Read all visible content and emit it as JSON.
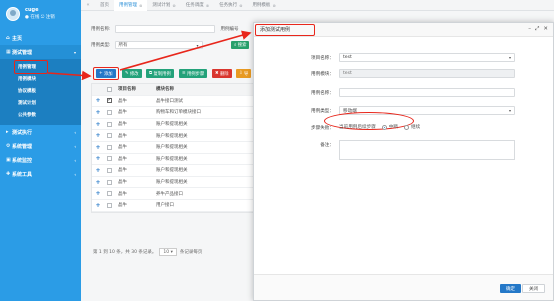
{
  "sidebar": {
    "user_name": "cuge",
    "user_status": "● 在线  ⎋ 注销",
    "items": [
      {
        "label": "主页",
        "icon": "home-icon"
      },
      {
        "label": "测试管理",
        "icon": "grid-icon"
      },
      {
        "label": "测试执行",
        "icon": "play-icon"
      },
      {
        "label": "系统管理",
        "icon": "gear-icon"
      },
      {
        "label": "系统监控",
        "icon": "monitor-icon"
      },
      {
        "label": "系统工具",
        "icon": "tools-icon"
      }
    ],
    "sub_items": [
      "用例管理",
      "用例模块",
      "协议模板",
      "测试计划",
      "公共参数"
    ]
  },
  "tabs": [
    "首页",
    "用例管理",
    "测试计划",
    "任务调度",
    "任务执行",
    "用例模板"
  ],
  "search": {
    "case_name_label": "用例名称:",
    "case_no_label": "用例编号",
    "case_type_label": "用例类型:",
    "case_type_value": "所有",
    "search_label": "搜索"
  },
  "toolbar": {
    "add_label": "添加",
    "edit_label": "修改",
    "copy_label": "复制用例",
    "export_label": "用例步骤",
    "delete_label": "删除",
    "more_label": "导"
  },
  "table": {
    "headers": [
      "项目名称",
      "模块名称"
    ],
    "rows": [
      {
        "project": "晶牛",
        "module": "晶牛接口测试",
        "checked": true
      },
      {
        "project": "晶牛",
        "module": "购物车和订单模块接口",
        "checked": false
      },
      {
        "project": "晶牛",
        "module": "账户和提现相关",
        "checked": false
      },
      {
        "project": "晶牛",
        "module": "账户和提现相关",
        "checked": false
      },
      {
        "project": "晶牛",
        "module": "账户和提现相关",
        "checked": false
      },
      {
        "project": "晶牛",
        "module": "账户和提现相关",
        "checked": false
      },
      {
        "project": "晶牛",
        "module": "账户和提现相关",
        "checked": false
      },
      {
        "project": "晶牛",
        "module": "账户和提现相关",
        "checked": false
      },
      {
        "project": "晶牛",
        "module": "养牛产品接口",
        "checked": false
      },
      {
        "project": "晶牛",
        "module": "用户接口",
        "checked": false
      }
    ]
  },
  "pager": {
    "summary": "第 1 到 10 条，共 30 条记录。",
    "per_page": "10",
    "suffix": "条记录每页"
  },
  "dialog": {
    "title": "添加测试用例",
    "project_label": "项目名称：",
    "project_value": "test",
    "module_label": "用例模块：",
    "module_value": "test",
    "name_label": "用例名称：",
    "name_value": "",
    "type_label": "用例类型：",
    "type_value": "移动端",
    "steps_label": "步骤失败：",
    "steps_text": "当前用例后续步骤",
    "radio_stop": "中断",
    "radio_continue": "继续",
    "remark_label": "备注：",
    "ok_label": "确定",
    "close_label": "关闭"
  },
  "colors": {
    "sidebar": "#2b9ce6",
    "highlight": "#e8261b",
    "primary": "#2478c8",
    "success": "#23a27a"
  }
}
